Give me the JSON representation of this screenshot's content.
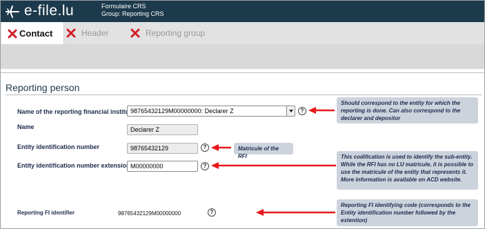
{
  "header": {
    "logo": "e-file.lu",
    "form_name": "Formulaire CRS",
    "group": "Group: Reporting CRS"
  },
  "tabs": [
    {
      "label": "Contact",
      "active": true
    },
    {
      "label": "Header",
      "active": false
    },
    {
      "label": "Reporting group",
      "active": false
    }
  ],
  "section": {
    "title": "Reporting person"
  },
  "fields": {
    "institute": {
      "label": "Name of the reporting financial institute",
      "value": "98765432129M00000000: Declarer Z"
    },
    "name": {
      "label": "Name",
      "value": "Declarer Z"
    },
    "entity_id": {
      "label": "Entity identification number",
      "value": "98765432129"
    },
    "entity_ext": {
      "label": "Entity identification number extension",
      "value": "M00000000"
    },
    "fi_identifier": {
      "label": "Reporting FI identifier",
      "value": "98765432129M00000000"
    }
  },
  "help_symbol": "?",
  "notes": {
    "institute": "Should correspond to the entity for which the reporting is done. Can also correspond to the declarer and depositor",
    "entity_id": "Matricule of the RFI",
    "entity_ext": "This codification is used to identify the sub-entity. While the RFI has no LU matricule, it is possible to use the matricule of the entity that represents it. More information is available on ACD website.",
    "fi_identifier": "Reporting FI identifying code (corresponds to the Entity identification number followed by the extention)"
  },
  "colors": {
    "header_bg": "#1d3a4c",
    "arrow": "#e8171b",
    "note_bg": "#cdd3dd",
    "tab_x": "#d21e2a"
  }
}
